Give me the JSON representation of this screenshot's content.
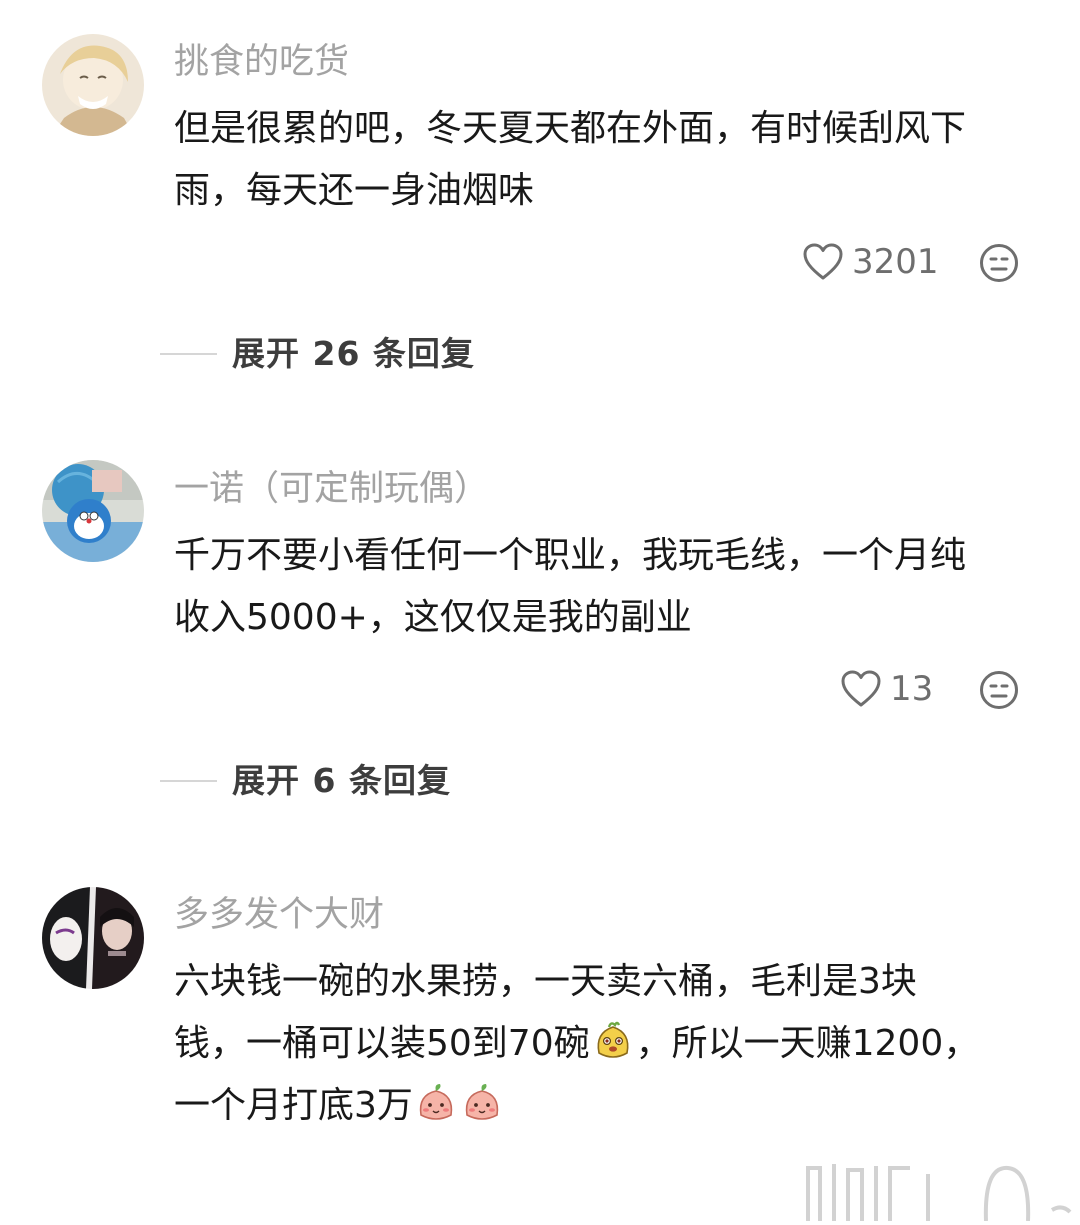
{
  "comments": [
    {
      "username": "挑食的吃货",
      "lines": [
        "但是很累的吧，冬天夏天都在外面，有时候刮风下",
        "雨，每天还一身油烟味"
      ],
      "likes": "3201",
      "replies_label": "展开 26 条回复"
    },
    {
      "username": "一诺（可定制玩偶）",
      "lines": [
        "千万不要小看任何一个职业，我玩毛线，一个月纯",
        "收入5000+，这仅仅是我的副业"
      ],
      "likes": "13",
      "replies_label": "展开 6 条回复"
    },
    {
      "username": "多多发个大财",
      "line1": "六块钱一碗的水果捞，一天卖六桶，毛利是3块",
      "line2_a": "钱，一桶可以装50到70碗",
      "line2_b": "，所以一天赚1200，",
      "line3": "一个月打底3万"
    }
  ],
  "icons": {
    "like": "heart-outline-icon",
    "dislike": "meh-face-icon",
    "emoji_1": "yellow-blob-sticker",
    "emoji_2": "pink-peach-sticker"
  },
  "colors": {
    "username": "#a3a3a3",
    "text": "#191919",
    "meta": "#6e6e6e",
    "divider": "#d6d6d6"
  }
}
